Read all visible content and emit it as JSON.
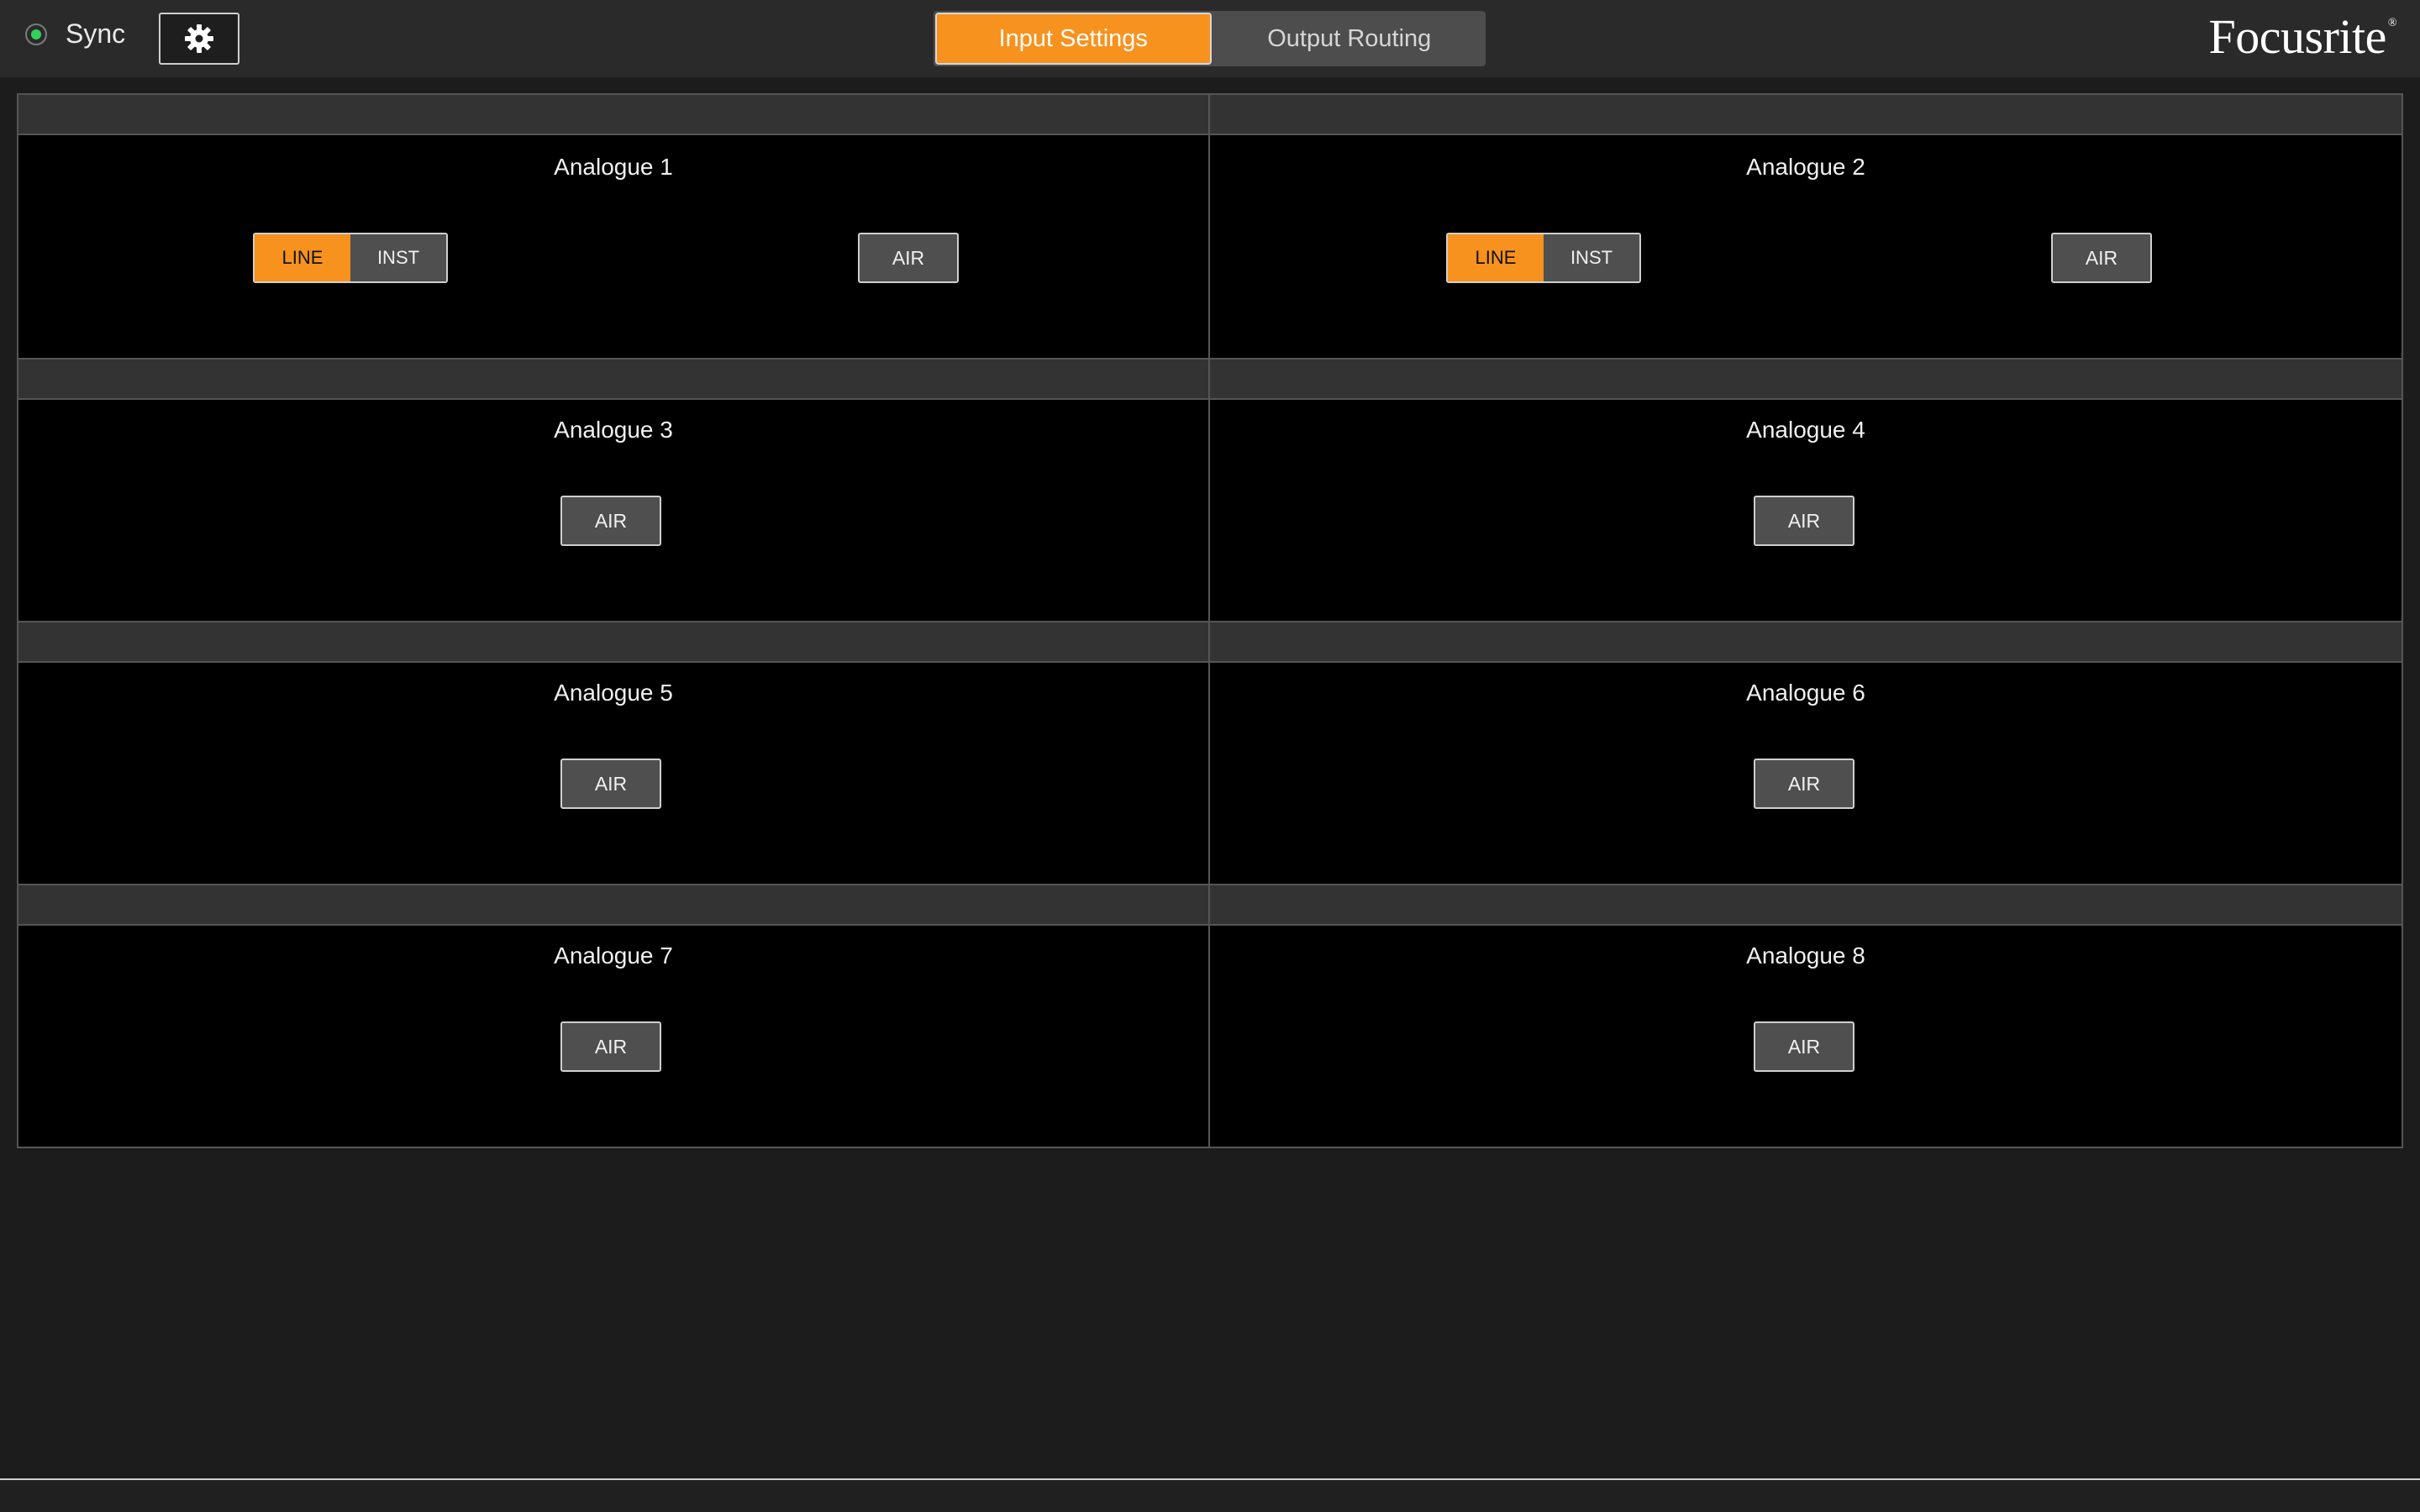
{
  "header": {
    "sync_label": "Sync",
    "settings_icon": "gear-icon",
    "tabs": [
      {
        "label": "Input Settings",
        "active": true
      },
      {
        "label": "Output Routing",
        "active": false
      }
    ],
    "logo": "Focusrite"
  },
  "colors": {
    "accent": "#f7921e",
    "sync_indicator": "#33d15c",
    "panel_bg": "#000000",
    "app_bg": "#1c1c1c"
  },
  "channels": [
    {
      "name": "Analogue 1",
      "line_label": "LINE",
      "inst_label": "INST",
      "mode": "LINE",
      "air_label": "AIR"
    },
    {
      "name": "Analogue 2",
      "line_label": "LINE",
      "inst_label": "INST",
      "mode": "LINE",
      "air_label": "AIR"
    },
    {
      "name": "Analogue 3",
      "air_label": "AIR"
    },
    {
      "name": "Analogue 4",
      "air_label": "AIR"
    },
    {
      "name": "Analogue 5",
      "air_label": "AIR"
    },
    {
      "name": "Analogue 6",
      "air_label": "AIR"
    },
    {
      "name": "Analogue 7",
      "air_label": "AIR"
    },
    {
      "name": "Analogue 8",
      "air_label": "AIR"
    }
  ]
}
